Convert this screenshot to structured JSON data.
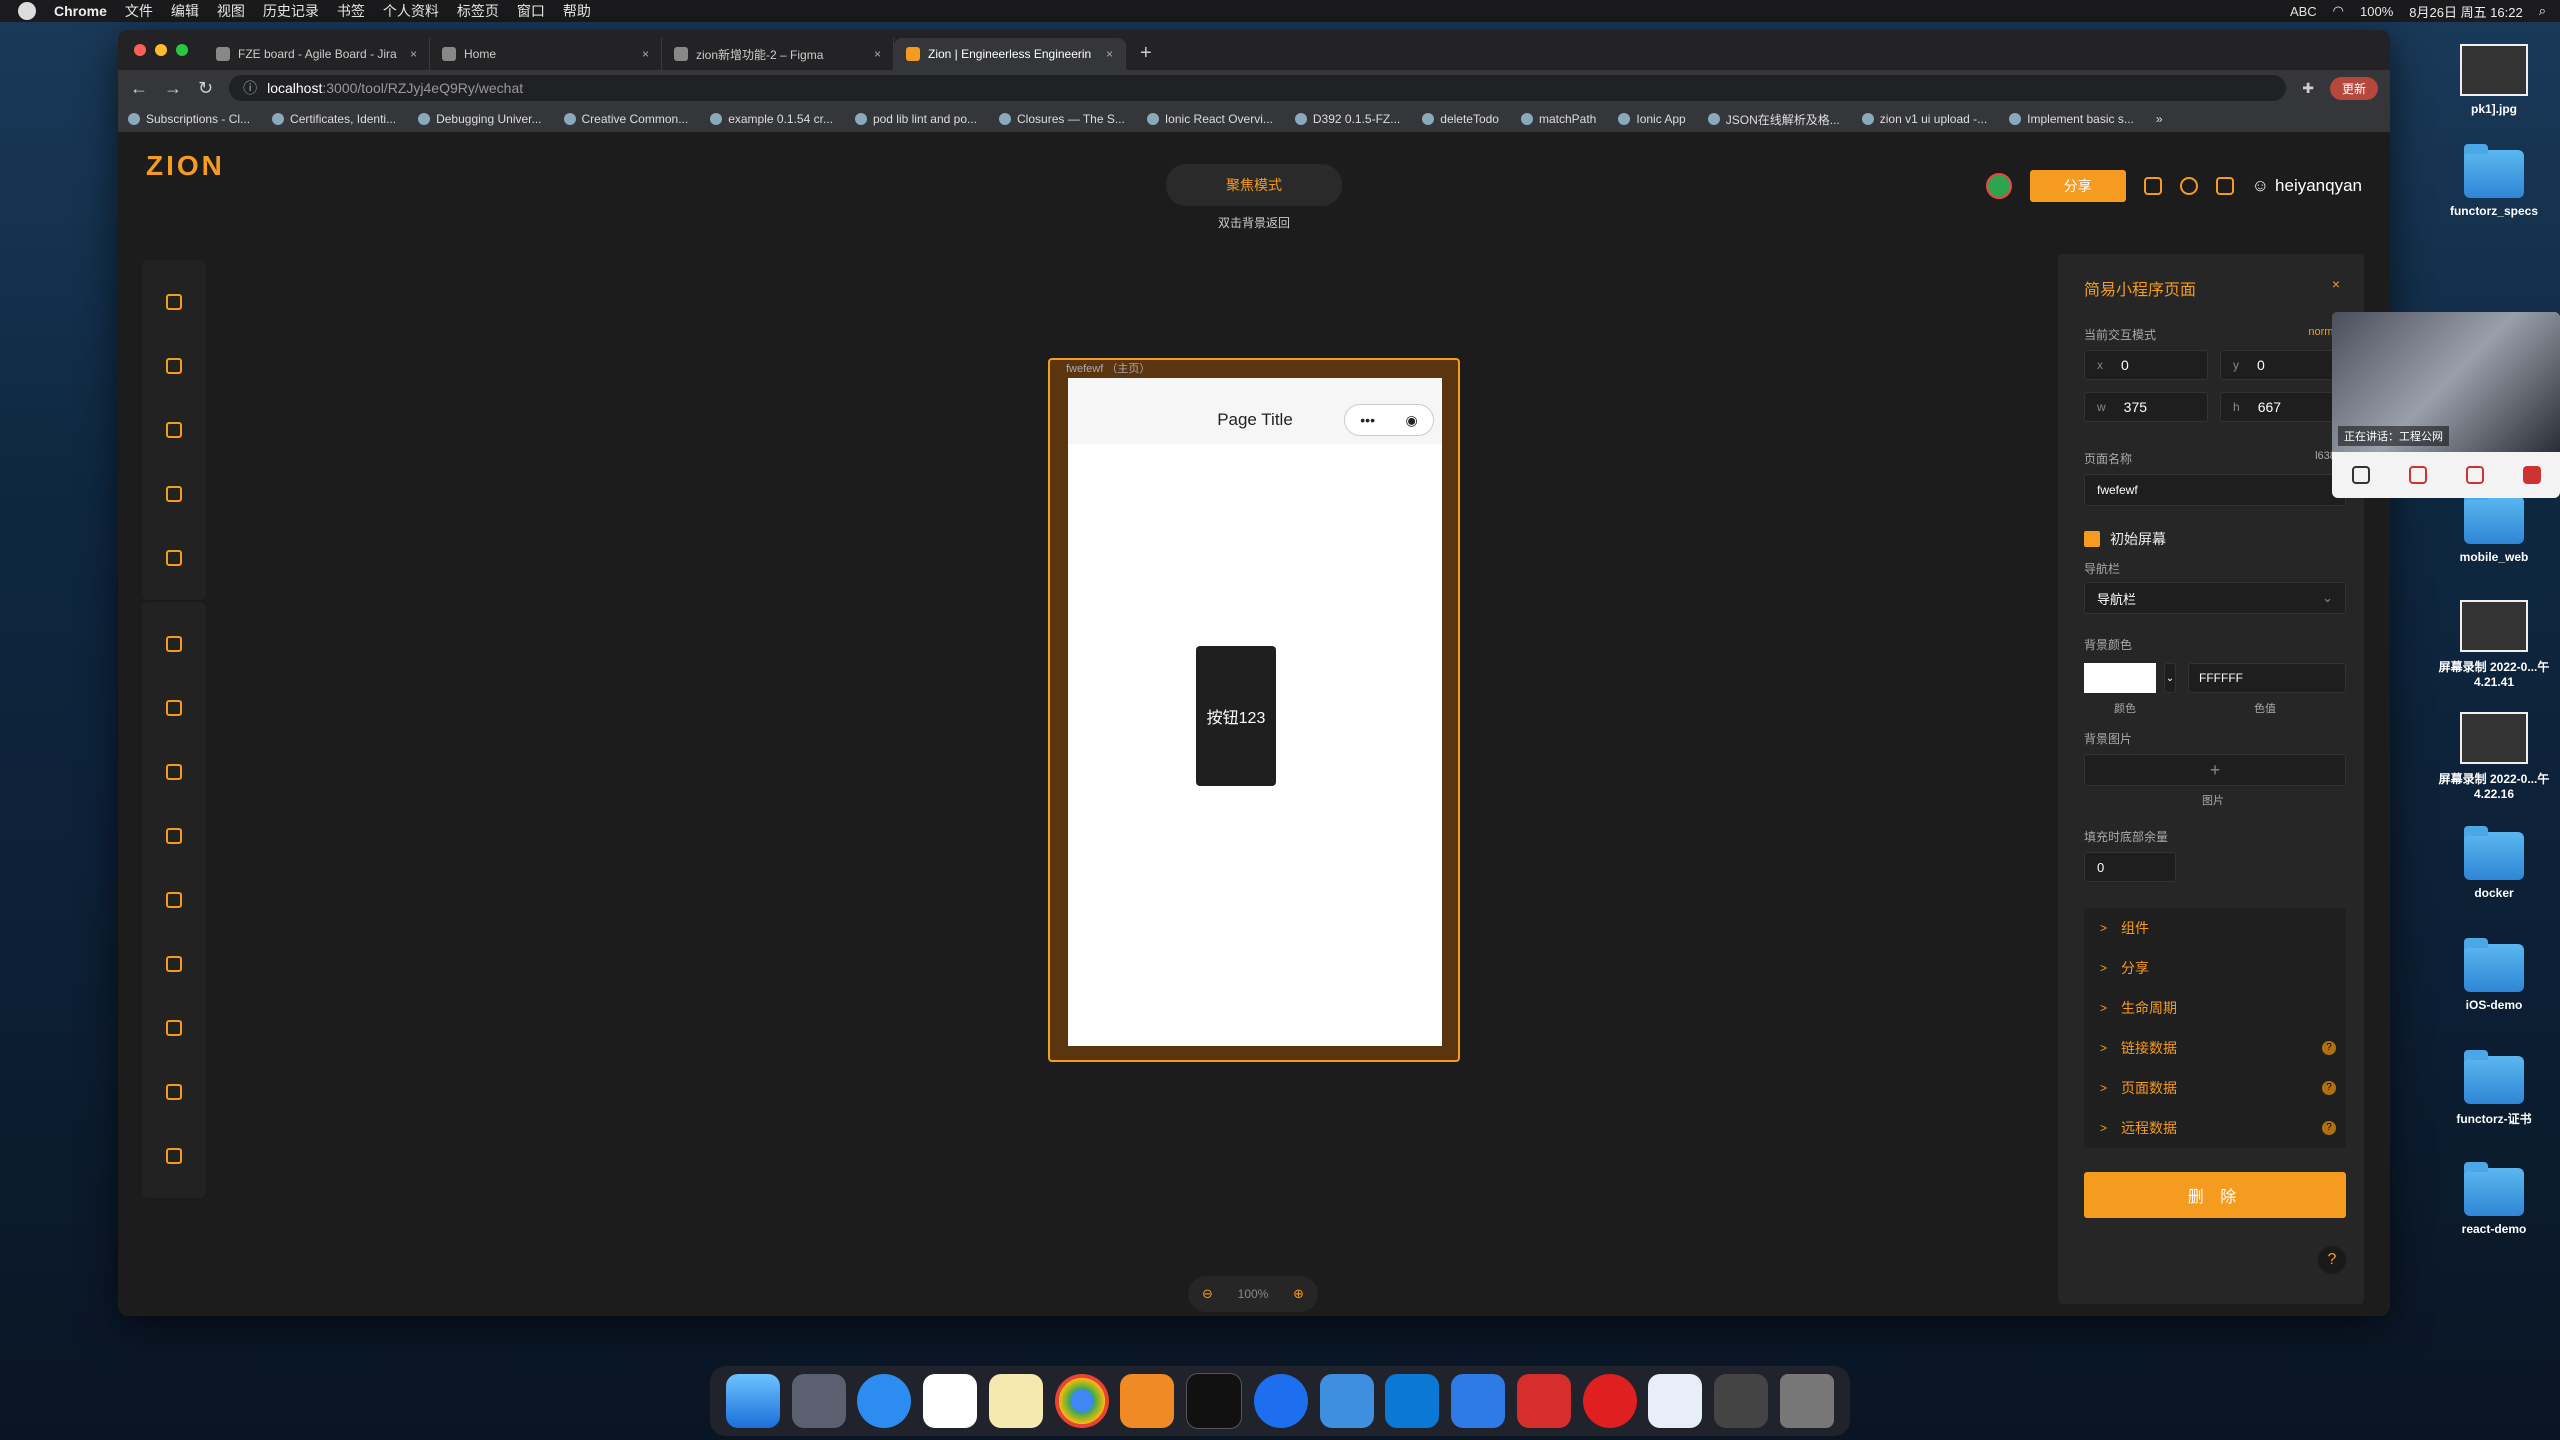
{
  "menubar": {
    "app": "Chrome",
    "items": [
      "文件",
      "编辑",
      "视图",
      "历史记录",
      "书签",
      "个人资料",
      "标签页",
      "窗口",
      "帮助"
    ],
    "battery": "100%",
    "datetime": "8月26日 周五 16:22",
    "input": "ABC"
  },
  "desktop": {
    "icons": [
      {
        "label": "pk1].jpg"
      },
      {
        "label": "functorz_specs"
      },
      {
        "label": "mobile_web"
      },
      {
        "label": "屏幕录制 2022-0...午4.21.41"
      },
      {
        "label": "屏幕录制 2022-0...午4.22.16"
      },
      {
        "label": "docker"
      },
      {
        "label": "iOS-demo"
      },
      {
        "label": "functorz-证书"
      },
      {
        "label": "react-demo"
      }
    ]
  },
  "browser": {
    "tabs": [
      {
        "title": "FZE board - Agile Board - Jira"
      },
      {
        "title": "Home"
      },
      {
        "title": "zion新增功能-2 – Figma"
      },
      {
        "title": "Zion | Engineerless Engineerin"
      }
    ],
    "new_tab": "+",
    "url_host": "localhost",
    "url_path": ":3000/tool/RZJyj4eQ9Ry/wechat",
    "update_label": "更新",
    "bookmarks": [
      "Subscriptions - Cl...",
      "Certificates, Identi...",
      "Debugging Univer...",
      "Creative Common...",
      "example 0.1.54 cr...",
      "pod lib lint and po...",
      "Closures — The S...",
      "Ionic React Overvi...",
      "D392 0.1.5-FZ...",
      "deleteTodo",
      "matchPath",
      "Ionic App",
      "JSON在线解析及格...",
      "zion v1 ui upload -...",
      "Implement basic s..."
    ],
    "bookmarks_more": "»"
  },
  "app": {
    "logo": "ZION",
    "focus_mode": "聚焦模式",
    "focus_hint": "双击背景返回",
    "share": "分享",
    "username": "heiyanqyan",
    "colors": {
      "accent": "#f59b20",
      "bg": "#1c1c1c",
      "panel": "#262626"
    }
  },
  "canvas": {
    "frame_label": "fwefewf （主页）",
    "page_title": "Page Title",
    "capsule_more": "•••",
    "capsule_close": "◉",
    "button_text": "按钮123",
    "zoom_out": "⊖",
    "zoom_in": "⊕",
    "zoom_level": "100%"
  },
  "panel": {
    "title": "简易小程序页面",
    "close": "×",
    "interaction_label": "当前交互模式",
    "interaction_value": "normal",
    "x_key": "x",
    "x": "0",
    "y_key": "y",
    "y": "0",
    "w_key": "w",
    "w": "375",
    "h_key": "h",
    "h": "667",
    "page_name_label": "页面名称",
    "page_name_id": "l6387",
    "page_name": "fwefewf",
    "initial_screen": "初始屏幕",
    "navbar_label": "导航栏",
    "navbar_value": "导航栏",
    "bgcolor_label": "背景颜色",
    "bgcolor_hex": "FFFFFF",
    "color_caption": "颜色",
    "value_caption": "色值",
    "bgimage_label": "背景图片",
    "image_caption": "图片",
    "bottom_fill_label": "填充时底部余量",
    "bottom_fill": "0",
    "sections": [
      "组件",
      "分享",
      "生命周期",
      "链接数据",
      "页面数据",
      "远程数据"
    ],
    "delete": "删 除",
    "help": "?"
  },
  "video_call": {
    "caption": "正在讲话：工程公网"
  }
}
